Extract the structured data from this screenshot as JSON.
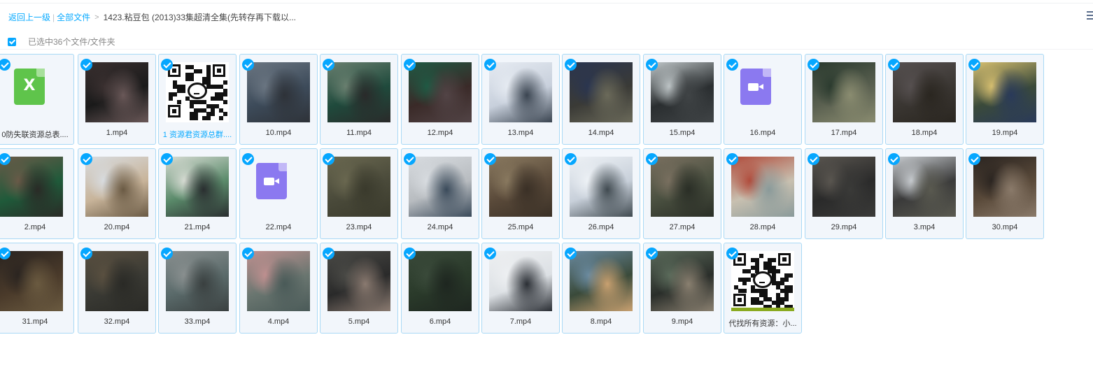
{
  "breadcrumb": {
    "back": "返回上一级",
    "sep": "|",
    "all_files": "全部文件",
    "gt": ">",
    "current": "1423.粘豆包 (2013)33集超清全集(先转存再下载以..."
  },
  "selection": {
    "text": "已选中36个文件/文件夹"
  },
  "colors": {
    "accent": "#06a7ff",
    "tile_bg": "#f2f6fb",
    "tile_border": "#a9d9f5"
  },
  "files": [
    {
      "name": "0防失联资源总表....",
      "thumb": "excel-icon",
      "colors": [
        "#5fc44b"
      ]
    },
    {
      "name": "1.mp4",
      "thumb": "video-frame",
      "colors": [
        "#1a1a1a",
        "#3a3030",
        "#6a5858"
      ]
    },
    {
      "name": "1 资源君资源总群....",
      "thumb": "qr-code",
      "blue": true
    },
    {
      "name": "10.mp4",
      "thumb": "video-frame",
      "colors": [
        "#3d4b5a",
        "#6b7682",
        "#2e3238"
      ]
    },
    {
      "name": "11.mp4",
      "thumb": "video-frame",
      "colors": [
        "#1f4a3c",
        "#6a8070",
        "#2a2a2a"
      ]
    },
    {
      "name": "12.mp4",
      "thumb": "video-frame",
      "colors": [
        "#3a2a28",
        "#1f5a44",
        "#524446"
      ]
    },
    {
      "name": "13.mp4",
      "thumb": "video-frame",
      "colors": [
        "#c8d0dc",
        "#e6ebf2",
        "#3a4450"
      ]
    },
    {
      "name": "14.mp4",
      "thumb": "video-frame",
      "colors": [
        "#3a3a36",
        "#2a3550",
        "#6b6a5a"
      ]
    },
    {
      "name": "15.mp4",
      "thumb": "video-frame",
      "colors": [
        "#2a2e30",
        "#bfc6c8",
        "#404446"
      ]
    },
    {
      "name": "16.mp4",
      "thumb": "video-icon",
      "colors": [
        "#8b79f0"
      ]
    },
    {
      "name": "17.mp4",
      "thumb": "video-frame",
      "colors": [
        "#5a6050",
        "#2a3a2e",
        "#8a8c70"
      ]
    },
    {
      "name": "18.mp4",
      "thumb": "video-frame",
      "colors": [
        "#3a3632",
        "#565050",
        "#2a2620"
      ]
    },
    {
      "name": "19.mp4",
      "thumb": "video-frame",
      "colors": [
        "#3a4a3a",
        "#d8c070",
        "#2a3a5a"
      ]
    },
    {
      "name": "2.mp4",
      "thumb": "video-frame",
      "colors": [
        "#1f5a3a",
        "#6a5a48",
        "#2a2a26"
      ]
    },
    {
      "name": "20.mp4",
      "thumb": "video-frame",
      "colors": [
        "#c8b49a",
        "#d8dce0",
        "#6a5a44"
      ]
    },
    {
      "name": "21.mp4",
      "thumb": "video-frame",
      "colors": [
        "#5a8a6a",
        "#d8dcd4",
        "#2a2e30"
      ]
    },
    {
      "name": "22.mp4",
      "thumb": "video-icon",
      "colors": [
        "#8b79f0"
      ]
    },
    {
      "name": "23.mp4",
      "thumb": "video-frame",
      "colors": [
        "#4a4a3a",
        "#6a6850",
        "#3a3a2c"
      ]
    },
    {
      "name": "24.mp4",
      "thumb": "video-frame",
      "colors": [
        "#b8bcc0",
        "#d8dce0",
        "#3a4a5a"
      ]
    },
    {
      "name": "25.mp4",
      "thumb": "video-frame",
      "colors": [
        "#5a4a3a",
        "#8a7a60",
        "#3a3026"
      ]
    },
    {
      "name": "26.mp4",
      "thumb": "video-frame",
      "colors": [
        "#c8d0da",
        "#eef2f6",
        "#404a50"
      ]
    },
    {
      "name": "27.mp4",
      "thumb": "video-frame",
      "colors": [
        "#4a5040",
        "#7a7060",
        "#2a2e26"
      ]
    },
    {
      "name": "28.mp4",
      "thumb": "video-frame",
      "colors": [
        "#c8c0b0",
        "#b04a3a",
        "#8a9a9a"
      ]
    },
    {
      "name": "29.mp4",
      "thumb": "video-frame",
      "colors": [
        "#2a2a2a",
        "#5a5650",
        "#3a3a38"
      ]
    },
    {
      "name": "3.mp4",
      "thumb": "video-frame",
      "colors": [
        "#3a3a3a",
        "#c8ccd0",
        "#5a5a50"
      ]
    },
    {
      "name": "30.mp4",
      "thumb": "video-frame",
      "colors": [
        "#5a4a3a",
        "#2a2420",
        "#8a7a6a"
      ]
    },
    {
      "name": "31.mp4",
      "thumb": "video-frame",
      "colors": [
        "#4a3a2a",
        "#2a2420",
        "#6a5a40"
      ]
    },
    {
      "name": "32.mp4",
      "thumb": "video-frame",
      "colors": [
        "#3a3a34",
        "#5a5040",
        "#2a2a26"
      ]
    },
    {
      "name": "33.mp4",
      "thumb": "video-frame",
      "colors": [
        "#5a6a6a",
        "#8a9090",
        "#3a4040"
      ]
    },
    {
      "name": "4.mp4",
      "thumb": "video-frame",
      "colors": [
        "#6a7670",
        "#c09090",
        "#4a5a58"
      ]
    },
    {
      "name": "5.mp4",
      "thumb": "video-frame",
      "colors": [
        "#2a2a2a",
        "#4a4a46",
        "#8a7a70"
      ]
    },
    {
      "name": "6.mp4",
      "thumb": "video-frame",
      "colors": [
        "#2a3a2a",
        "#3a4a3a",
        "#1e2620"
      ]
    },
    {
      "name": "7.mp4",
      "thumb": "video-frame",
      "colors": [
        "#dce0e4",
        "#eef0f2",
        "#2a2e34"
      ]
    },
    {
      "name": "8.mp4",
      "thumb": "video-frame",
      "colors": [
        "#3a4a3a",
        "#6a8aa0",
        "#c8a070"
      ]
    },
    {
      "name": "9.mp4",
      "thumb": "video-frame",
      "colors": [
        "#2a2e2a",
        "#5a6a5a",
        "#8a8070"
      ]
    },
    {
      "name": "代找所有资源：小...",
      "thumb": "qr-code-green"
    }
  ]
}
